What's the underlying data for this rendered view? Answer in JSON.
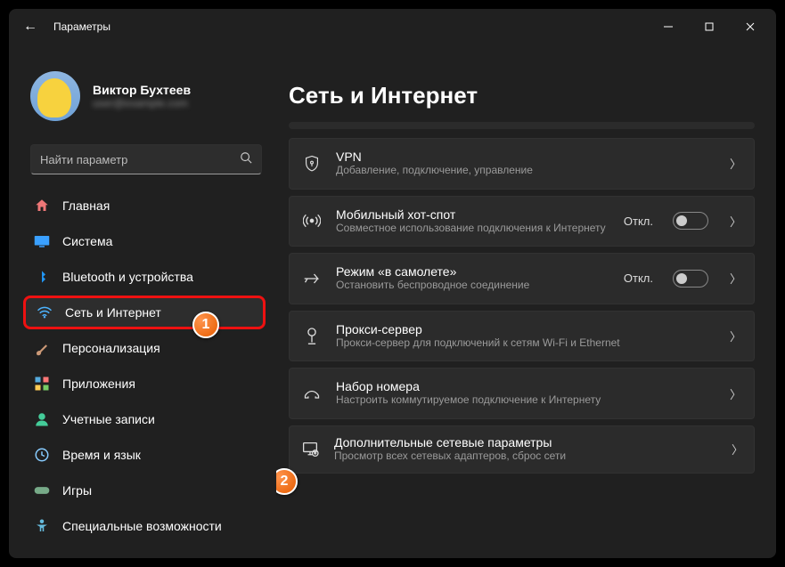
{
  "app_title": "Параметры",
  "profile": {
    "name": "Виктор Бухтеев",
    "sub": "user@example.com"
  },
  "search": {
    "placeholder": "Найти параметр"
  },
  "sidebar": {
    "items": [
      {
        "label": "Главная",
        "icon": "home"
      },
      {
        "label": "Система",
        "icon": "system"
      },
      {
        "label": "Bluetooth и устройства",
        "icon": "bluetooth"
      },
      {
        "label": "Сеть и Интернет",
        "icon": "wifi",
        "selected": true
      },
      {
        "label": "Персонализация",
        "icon": "brush"
      },
      {
        "label": "Приложения",
        "icon": "apps"
      },
      {
        "label": "Учетные записи",
        "icon": "account"
      },
      {
        "label": "Время и язык",
        "icon": "time"
      },
      {
        "label": "Игры",
        "icon": "games"
      },
      {
        "label": "Специальные возможности",
        "icon": "access"
      }
    ]
  },
  "page": {
    "title": "Сеть и Интернет"
  },
  "cards": [
    {
      "icon": "vpn",
      "title": "VPN",
      "sub": "Добавление, подключение, управление"
    },
    {
      "icon": "hotspot",
      "title": "Мобильный хот-спот",
      "sub": "Совместное использование подключения к Интернету",
      "status": "Откл.",
      "toggle": true
    },
    {
      "icon": "airplane",
      "title": "Режим «в самолете»",
      "sub": "Остановить беспроводное соединение",
      "status": "Откл.",
      "toggle": true
    },
    {
      "icon": "proxy",
      "title": "Прокси-сервер",
      "sub": "Прокси-сервер для подключений к сетям Wi-Fi и Ethernet"
    },
    {
      "icon": "dialup",
      "title": "Набор номера",
      "sub": "Настроить коммутируемое подключение к Интернету"
    },
    {
      "icon": "advanced",
      "title": "Дополнительные сетевые параметры",
      "sub": "Просмотр всех сетевых адаптеров, сброс сети"
    }
  ],
  "annotations": {
    "1": "1",
    "2": "2"
  }
}
